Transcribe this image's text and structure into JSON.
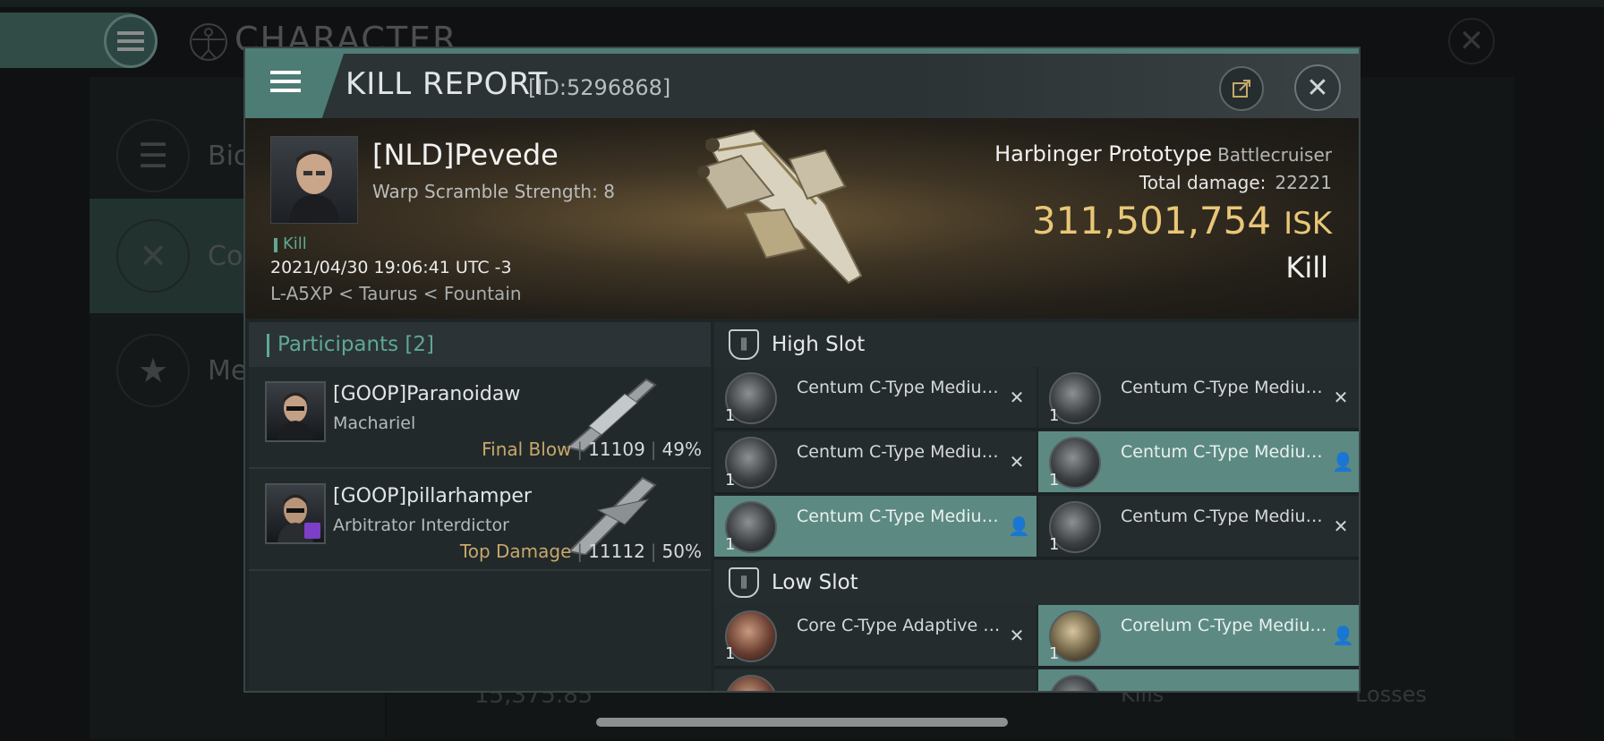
{
  "background": {
    "title": "CHARACTER",
    "side_items": [
      {
        "label": "Bio",
        "icon": "list-icon"
      },
      {
        "label": "Con",
        "icon": "crossed-swords-icon"
      },
      {
        "label": "Med",
        "icon": "star-badge-icon"
      }
    ],
    "bottom_value": "15,375.85",
    "kills_label": "Kills",
    "losses_label": "Losses"
  },
  "modal": {
    "title": "KILL REPORT",
    "id_text": "[ID:5296868]"
  },
  "victim": {
    "name": "[NLD]Pevede",
    "warp_scramble": "Warp Scramble Strength: 8",
    "tag": "Kill",
    "date": "2021/04/30 19:06:41 UTC -3",
    "location": "L-A5XP < Taurus < Fountain"
  },
  "ship": {
    "name": "Harbinger Prototype",
    "class": "Battlecruiser",
    "total_damage_label": "Total damage:",
    "total_damage_value": "22221",
    "isk_value": "311,501,754",
    "isk_unit": "ISK",
    "result": "Kill"
  },
  "participants": {
    "title": "Participants",
    "count": "[2]",
    "rows": [
      {
        "name": "[GOOP]Paranoidaw",
        "ship": "Machariel",
        "tag": "Final Blow",
        "damage": "11109",
        "percent": "49%"
      },
      {
        "name": "[GOOP]pillarhamper",
        "ship": "Arbitrator Interdictor",
        "tag": "Top Damage",
        "damage": "11112",
        "percent": "50%"
      }
    ]
  },
  "fitting": {
    "high_slot_title": "High Slot",
    "low_slot_title": "Low Slot",
    "high_modules": [
      {
        "name": "Centum C-Type Medium...",
        "qty": "1",
        "status": "destroyed"
      },
      {
        "name": "Centum C-Type Medium...",
        "qty": "1",
        "status": "destroyed"
      },
      {
        "name": "Centum C-Type Medium...",
        "qty": "1",
        "status": "destroyed"
      },
      {
        "name": "Centum C-Type Medium...",
        "qty": "1",
        "status": "dropped"
      },
      {
        "name": "Centum C-Type Medium...",
        "qty": "1",
        "status": "dropped"
      },
      {
        "name": "Centum C-Type Medium...",
        "qty": "1",
        "status": "destroyed"
      }
    ],
    "low_modules": [
      {
        "name": "Core C-Type Adaptive Armo...",
        "qty": "1",
        "status": "destroyed"
      },
      {
        "name": "Corelum C-Type Medium...",
        "qty": "1",
        "status": "dropped"
      }
    ]
  },
  "colors": {
    "accent": "#5fa896",
    "isk": "#e8c778",
    "highlight_row": "#5c8a83"
  }
}
